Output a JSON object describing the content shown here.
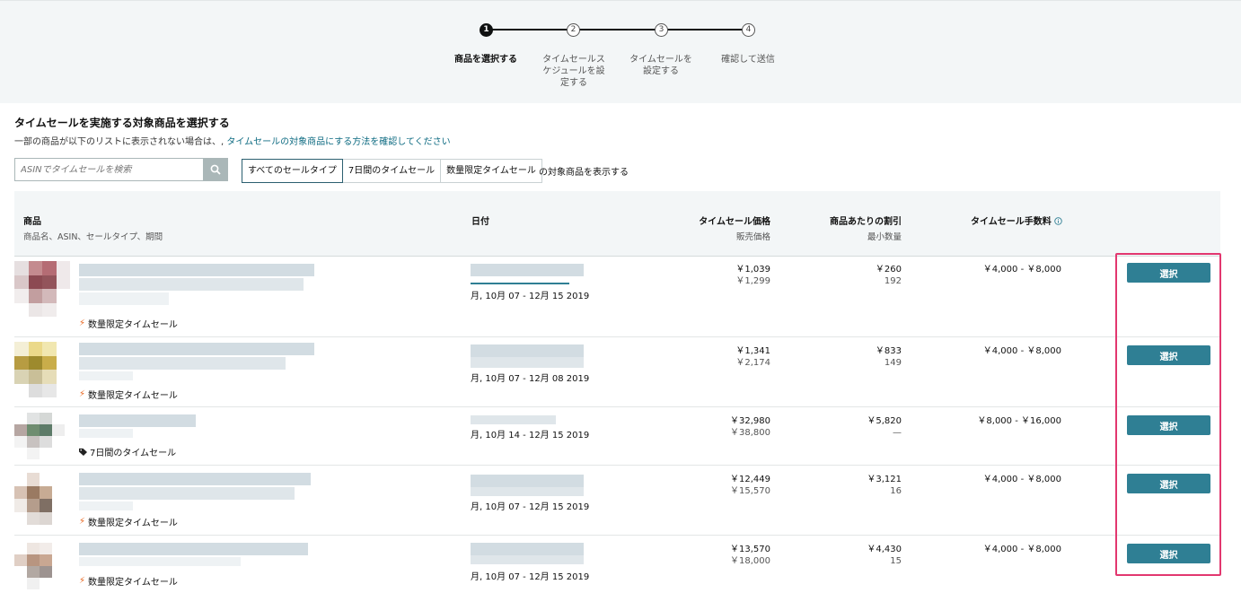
{
  "stepper": {
    "steps": [
      {
        "number": "1",
        "label": "商品を選択する",
        "active": true
      },
      {
        "number": "2",
        "label": "タイムセールスケジュールを設定する",
        "active": false
      },
      {
        "number": "3",
        "label": "タイムセールを設定する",
        "active": false
      },
      {
        "number": "4",
        "label": "確認して送信",
        "active": false
      }
    ]
  },
  "page": {
    "title": "タイムセールを実施する対象商品を選択する",
    "subtitle_prefix": "一部の商品が以下のリストに表示されない場合は、,",
    "subtitle_link": "タイムセールの対象商品にする方法を確認してください"
  },
  "search": {
    "placeholder": "ASINでタイムセールを検索",
    "icon": "search-icon"
  },
  "filters": {
    "options": [
      "すべてのセールタイプ",
      "7日間のタイムセール",
      "数量限定タイムセール"
    ],
    "selected": "すべてのセールタイプ",
    "suffix": "の対象商品を表示する"
  },
  "table": {
    "headers": {
      "product": "商品",
      "product_sub": "商品名、ASIN、セールタイプ、期間",
      "date": "日付",
      "price": "タイムセール価格",
      "price_sub": "販売価格",
      "discount": "商品あたりの割引",
      "discount_sub": "最小数量",
      "fee": "タイムセール手数料",
      "fee_icon": "info-icon"
    },
    "rows": [
      {
        "sale_type": "数量限定タイムセール",
        "sale_icon": "bolt-icon",
        "date": "月, 10月 07 - 12月 15 2019",
        "deal_price": "￥1,039",
        "list_price": "￥1,299",
        "discount": "￥260",
        "min_qty": "192",
        "fee": "￥4,000 - ￥8,000",
        "button": "選択"
      },
      {
        "sale_type": "数量限定タイムセール",
        "sale_icon": "bolt-icon",
        "date": "月, 10月 07 - 12月 08 2019",
        "deal_price": "￥1,341",
        "list_price": "￥2,174",
        "discount": "￥833",
        "min_qty": "149",
        "fee": "￥4,000 - ￥8,000",
        "button": "選択"
      },
      {
        "sale_type": "7日間のタイムセール",
        "sale_icon": "tag-icon",
        "date": "月, 10月 14 - 12月 15 2019",
        "deal_price": "￥32,980",
        "list_price": "￥38,800",
        "discount": "￥5,820",
        "min_qty": "—",
        "fee": "￥8,000 - ￥16,000",
        "button": "選択"
      },
      {
        "sale_type": "数量限定タイムセール",
        "sale_icon": "bolt-icon",
        "date": "月, 10月 07 - 12月 15 2019",
        "deal_price": "￥12,449",
        "list_price": "￥15,570",
        "discount": "￥3,121",
        "min_qty": "16",
        "fee": "￥4,000 - ￥8,000",
        "button": "選択"
      },
      {
        "sale_type": "数量限定タイムセール",
        "sale_icon": "bolt-icon",
        "date": "月, 10月 07 - 12月 15 2019",
        "deal_price": "￥13,570",
        "list_price": "￥18,000",
        "discount": "￥4,430",
        "min_qty": "15",
        "fee": "￥4,000 - ￥8,000",
        "button": "選択"
      }
    ]
  },
  "colors": {
    "accent": "#2f7f94",
    "highlight": "#e2376f",
    "bolt": "#e8631a"
  }
}
